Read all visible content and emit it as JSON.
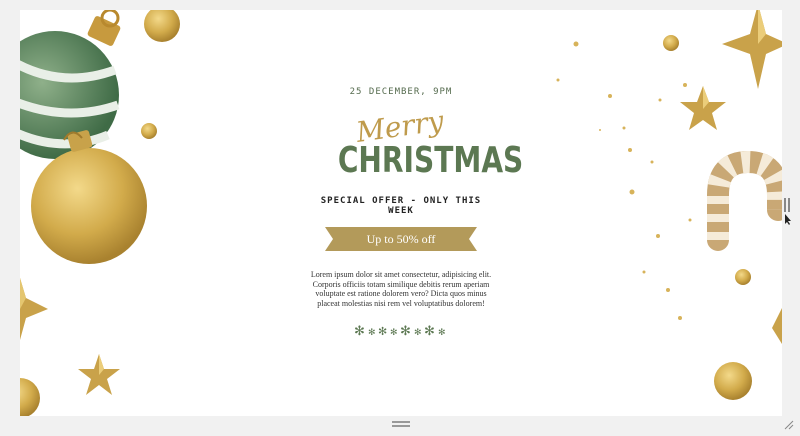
{
  "page": {
    "date_line": "25 DECEMBER, 9PM",
    "merry": "Merry",
    "christmas": "CHRISTMAS",
    "offer": "SPECIAL OFFER - ONLY THIS WEEK",
    "ribbon": "Up to 50% off",
    "lorem": "Lorem ipsum dolor sit amet consectetur, adipisicing elit. Corporis officiis totam similique debitis rerum aperiam voluptate est ratione dolorem vero? Dicta quos minus placeat molestias nisi rem vel voluptatibus dolorem!"
  },
  "colors": {
    "green": "#5c7852",
    "gold": "#bf9b4c",
    "ribbon": "#b39a5a",
    "background": "#ffffff"
  },
  "icons": [
    "snowflake-icon",
    "ornament-icon",
    "star-icon",
    "candy-cane-icon",
    "gold-ball-icon",
    "resize-handle-icon",
    "scroll-grip-icon"
  ]
}
